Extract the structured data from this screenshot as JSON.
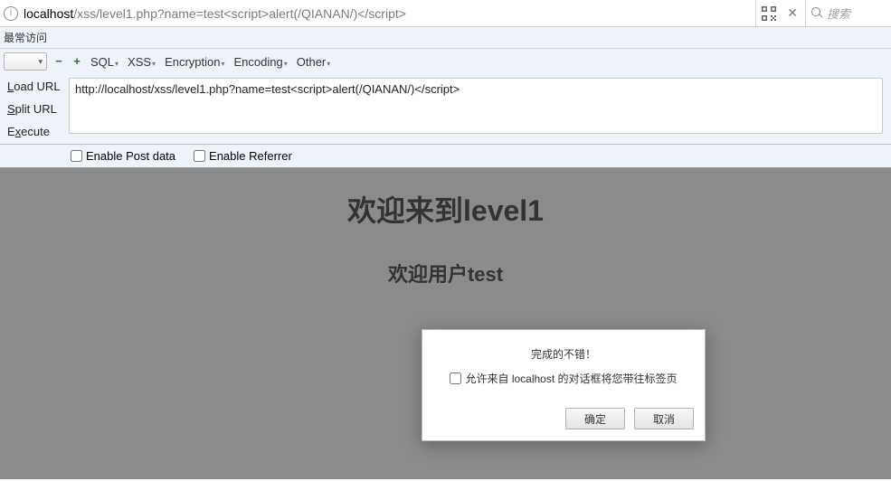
{
  "urlbar": {
    "host": "localhost",
    "path": "/xss/level1.php?name=test<script>alert(/QIANAN/)</script>",
    "search_placeholder": "搜索"
  },
  "bookmark": {
    "label": "最常访问"
  },
  "toolbar": {
    "sql": "SQL",
    "xss": "XSS",
    "encryption": "Encryption",
    "encoding": "Encoding",
    "other": "Other"
  },
  "hackbar": {
    "load_url": "Load URL",
    "split_url": "Split URL",
    "execute": "Execute",
    "url_value": "http://localhost/xss/level1.php?name=test<script>alert(/QIANAN/)</script>",
    "enable_post": "Enable Post data",
    "enable_referrer": "Enable Referrer"
  },
  "page": {
    "title": "欢迎来到level1",
    "subtitle": "欢迎用户test"
  },
  "dialog": {
    "message": "完成的不错！",
    "checkbox_label": "允许来自 localhost 的对话框将您带往标签页",
    "ok": "确定",
    "cancel": "取消"
  }
}
